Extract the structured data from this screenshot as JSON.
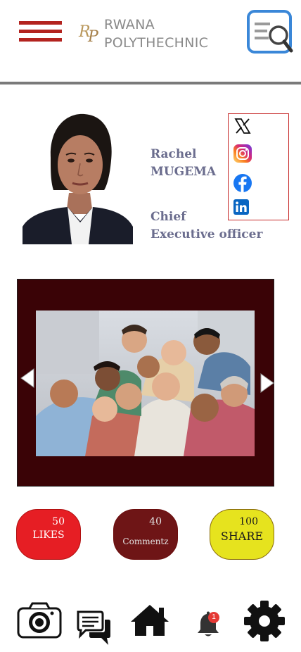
{
  "header": {
    "brand_line1": "RWANA",
    "brand_line2": "POLYTHECHNIC",
    "logo_text": "RP"
  },
  "profile": {
    "first_name": "Rachel",
    "last_name": "MUGEMA",
    "title_line1": "Chief",
    "title_line2": "Executive officer"
  },
  "social": [
    "x-icon",
    "instagram-icon",
    "facebook-icon",
    "linkedin-icon"
  ],
  "stats": {
    "likes": {
      "count": "50",
      "label": "LIKES"
    },
    "comments": {
      "count": "40",
      "label": "Commentz"
    },
    "share": {
      "count": "100",
      "label": "SHARE"
    }
  },
  "nav": {
    "notification_count": "1",
    "items": [
      "camera-icon",
      "chat-icon",
      "home-icon",
      "bell-icon",
      "gear-icon"
    ]
  },
  "colors": {
    "accent_red": "#b3231f",
    "gallery_bg": "#3a0306",
    "likes_bg": "#e61e24",
    "comments_bg": "#6e1516",
    "share_bg": "#e6e31e",
    "profile_text": "#6b6d8e"
  }
}
